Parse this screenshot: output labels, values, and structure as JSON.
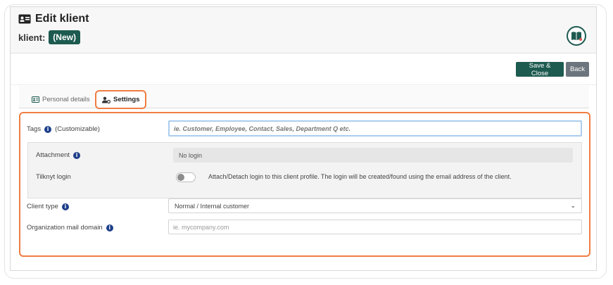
{
  "header": {
    "title": "Edit klient",
    "subtitle_label": "klient:",
    "badge": "(New)"
  },
  "toolbar": {
    "save_close": "Save & Close",
    "back": "Back"
  },
  "tabs": [
    {
      "label": "Personal details",
      "icon": "id-card-icon",
      "active": false
    },
    {
      "label": "Settings",
      "icon": "user-gear-icon",
      "active": true
    }
  ],
  "settings": {
    "tags": {
      "label": "Tags",
      "note": "(Customizable)",
      "placeholder": "ie. Customer, Employee, Contact, Sales, Department Q etc."
    },
    "attachment": {
      "label": "Attachment",
      "value": "No login"
    },
    "login": {
      "label": "Tilknyt login",
      "description": "Attach/Detach login to this client profile. The login will be created/found using the email address of the client.",
      "enabled": false
    },
    "client_type": {
      "label": "Client type",
      "selected": "Normal / Internal customer"
    },
    "mail_domain": {
      "label": "Organization mail domain",
      "placeholder": "ie. mycompany.com"
    }
  },
  "colors": {
    "brand": "#1d5a50",
    "highlight": "#ef7d42",
    "info": "#1d3f8a"
  }
}
